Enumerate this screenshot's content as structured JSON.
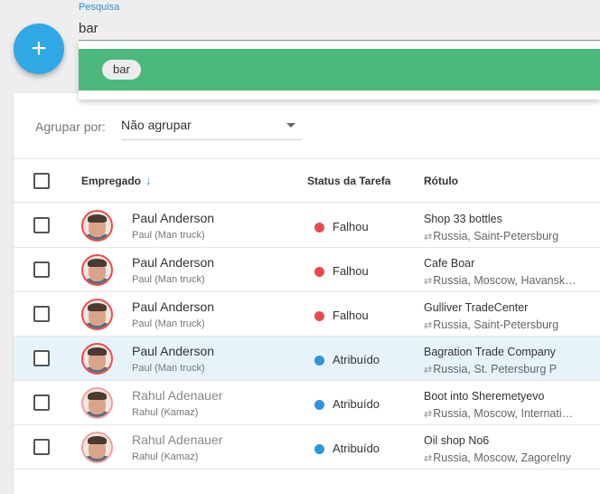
{
  "search": {
    "label": "Pesquisa",
    "value": "bar",
    "suggestion_chip": "bar"
  },
  "fab": {
    "icon": "plus-icon",
    "glyph": "+",
    "color": "#2fa8e6"
  },
  "toolbar": {
    "group_label": "Agrupar por:",
    "group_value": "Não agrupar"
  },
  "table": {
    "columns": {
      "employee": "Empregado",
      "status": "Status da Tarefa",
      "label": "Rótulo"
    },
    "sort_icon": "arrow-down-icon",
    "rows": [
      {
        "name": "Paul Anderson",
        "sub": "Paul (Man truck)",
        "status": "Falhou",
        "status_color": "#e84c4c",
        "label": "Shop 33 bottles",
        "address": "Russia, Saint-Petersburg",
        "selected": false
      },
      {
        "name": "Paul Anderson",
        "sub": "Paul (Man truck)",
        "status": "Falhou",
        "status_color": "#e84c4c",
        "label": "Cafe Boar",
        "address": "Russia, Moscow, Havanskaya",
        "selected": false
      },
      {
        "name": "Paul Anderson",
        "sub": "Paul (Man truck)",
        "status": "Falhou",
        "status_color": "#e84c4c",
        "label": "Gulliver TradeCenter",
        "address": "Russia, Saint-Petersburg",
        "selected": false
      },
      {
        "name": "Paul Anderson",
        "sub": "Paul (Man truck)",
        "status": "Atribuído",
        "status_color": "#2b95dd",
        "label": "Bagration Trade Company",
        "address": "Russia, St. Petersburg P",
        "selected": true
      },
      {
        "name": "Rahul Adenauer",
        "sub": "Rahul (Kamaz)",
        "status": "Atribuído",
        "status_color": "#2b95dd",
        "label": "Boot into Sheremetyevo",
        "address": "Russia, Moscow, International",
        "selected": false
      },
      {
        "name": "Rahul Adenauer",
        "sub": "Rahul (Kamaz)",
        "status": "Atribuído",
        "status_color": "#2b95dd",
        "label": "Oil shop No6",
        "address": "Russia, Moscow, Zagorelny",
        "selected": false
      }
    ]
  }
}
